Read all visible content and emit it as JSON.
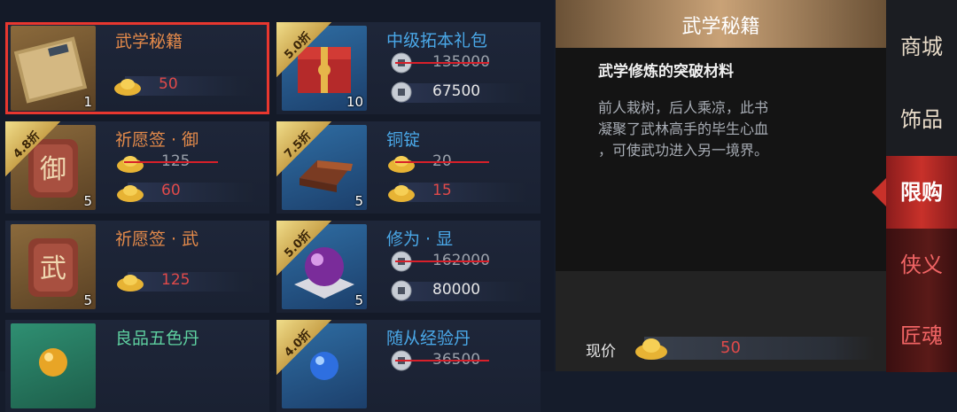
{
  "items": [
    {
      "name": "武学秘籍",
      "name_color": "orange",
      "icon": "scroll-book-icon",
      "rarity": "gold",
      "qty": "1",
      "badge": "",
      "orig_price": "",
      "price": "50",
      "currency": "gold-ingot",
      "selected": true
    },
    {
      "name": "中级拓本礼包",
      "name_color": "blue",
      "icon": "red-gift-box-icon",
      "rarity": "blue",
      "qty": "10",
      "badge": "5.0折",
      "orig_price": "135000",
      "price": "67500",
      "currency": "copper-coin",
      "selected": false
    },
    {
      "name": "祈愿签 · 御",
      "name_color": "orange",
      "icon": "wish-token-yu-icon",
      "rarity": "gold",
      "qty": "5",
      "badge": "4.8折",
      "orig_price": "125",
      "price": "60",
      "currency": "gold-ingot",
      "selected": false
    },
    {
      "name": "铜锭",
      "name_color": "blue",
      "icon": "copper-ingot-icon",
      "rarity": "blue",
      "qty": "5",
      "badge": "7.5折",
      "orig_price": "20",
      "price": "15",
      "currency": "gold-ingot",
      "selected": false
    },
    {
      "name": "祈愿签 · 武",
      "name_color": "orange",
      "icon": "wish-token-wu-icon",
      "rarity": "gold",
      "qty": "5",
      "badge": "",
      "orig_price": "",
      "price": "125",
      "currency": "gold-ingot",
      "selected": false
    },
    {
      "name": "修为 · 显",
      "name_color": "blue",
      "icon": "purple-orb-icon",
      "rarity": "blue",
      "qty": "5",
      "badge": "5.0折",
      "orig_price": "162000",
      "price": "80000",
      "currency": "copper-coin",
      "selected": false
    },
    {
      "name": "良品五色丹",
      "name_color": "green",
      "icon": "golden-pill-icon",
      "rarity": "green",
      "qty": "",
      "badge": "",
      "orig_price": "",
      "price": "",
      "currency": "",
      "selected": false
    },
    {
      "name": "随从经验丹",
      "name_color": "green",
      "icon": "blue-pill-icon",
      "rarity": "green",
      "qty": "",
      "badge": "4.0折",
      "orig_price": "36500",
      "price": "",
      "currency": "copper-coin",
      "selected": false
    }
  ],
  "detail": {
    "title": "武学秘籍",
    "subtitle": "武学修炼的突破材料",
    "description": "前人栽树，后人乘凉，此书\n凝聚了武林高手的毕生心血\n，可使武功进入另一境界。",
    "price_label": "现价",
    "price_value": "50",
    "price_icon": "gold-ingot-icon"
  },
  "tabs": [
    {
      "label": "商城",
      "state": "normal"
    },
    {
      "label": "饰品",
      "state": "normal"
    },
    {
      "label": "限购",
      "state": "active"
    },
    {
      "label": "侠义",
      "state": "red"
    },
    {
      "label": "匠魂",
      "state": "red"
    }
  ],
  "colors": {
    "selected_border": "#e8372f",
    "price_red": "#e04a4a",
    "strike": "#d8202a",
    "tab_active": "#c8312a",
    "detail_header": "#c9a277"
  }
}
